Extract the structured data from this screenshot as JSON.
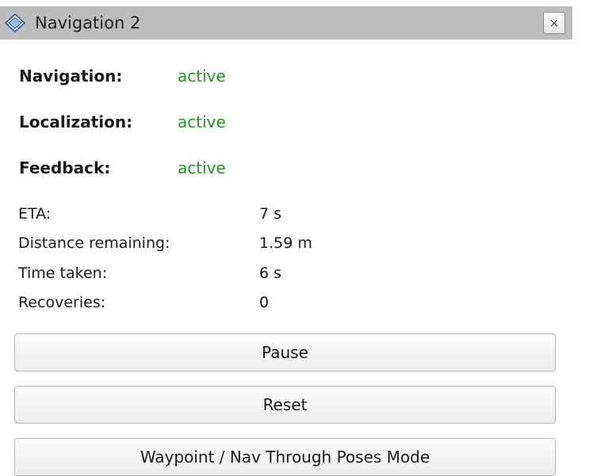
{
  "panel": {
    "title": "Navigation 2",
    "close_label": "×",
    "icon": "diamond-icon"
  },
  "status": [
    {
      "label": "Navigation:",
      "value": "active"
    },
    {
      "label": "Localization:",
      "value": "active"
    },
    {
      "label": "Feedback:",
      "value": "active"
    }
  ],
  "stats": [
    {
      "label": "ETA:",
      "value": "7 s"
    },
    {
      "label": "Distance remaining:",
      "value": "1.59 m"
    },
    {
      "label": "Time taken:",
      "value": "6 s"
    },
    {
      "label": "Recoveries:",
      "value": "0"
    }
  ],
  "buttons": {
    "pause": "Pause",
    "reset": "Reset",
    "waypoint_mode": "Waypoint / Nav Through Poses Mode"
  },
  "colors": {
    "active": "#1e9a1e",
    "titlebar": "#bdbdbd"
  }
}
